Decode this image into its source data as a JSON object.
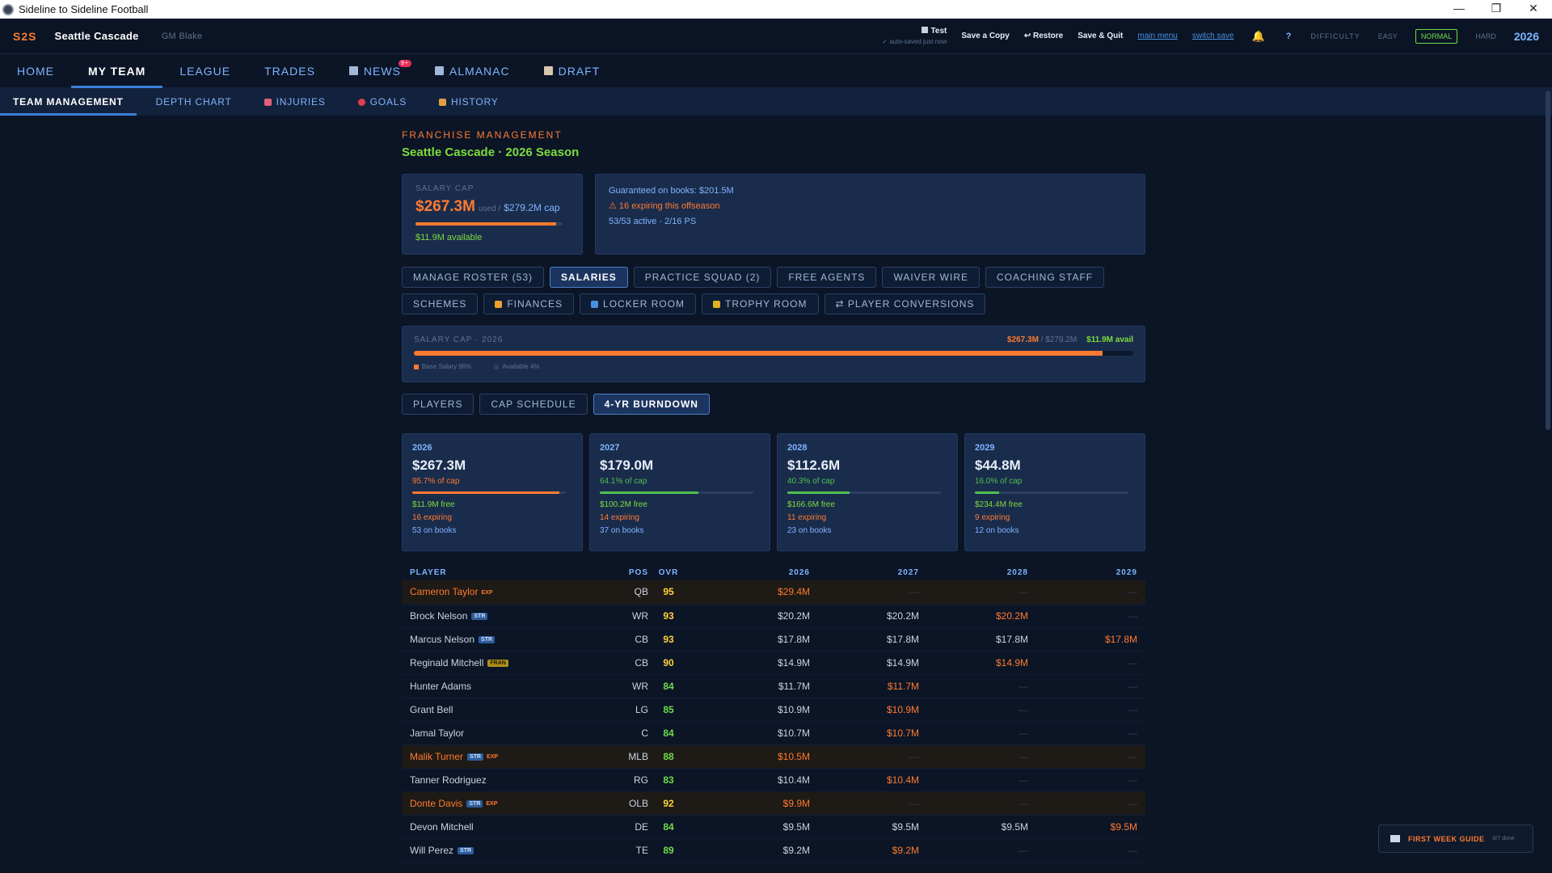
{
  "window": {
    "title": "Sideline to Sideline Football",
    "controls": [
      "—",
      "❐",
      "✕"
    ]
  },
  "topbar": {
    "logo": "S2S",
    "team": "Seattle Cascade",
    "gm": "GM Blake",
    "save_name": "Test",
    "save_status": "✓ auto-saved just now",
    "save_copy": "Save a Copy",
    "restore": "↩ Restore",
    "save_quit": "Save & Quit",
    "main_menu": "main menu",
    "switch_save": "switch save",
    "help": "?",
    "difficulty_label": "DIFFICULTY",
    "difficulty_options": [
      "EASY",
      "NORMAL",
      "HARD"
    ],
    "year": "2026"
  },
  "nav": {
    "items": [
      {
        "label": "HOME"
      },
      {
        "label": "MY TEAM",
        "active": true
      },
      {
        "label": "LEAGUE"
      },
      {
        "label": "TRADES"
      },
      {
        "label": "NEWS",
        "badge": "9+"
      },
      {
        "label": "ALMANAC"
      },
      {
        "label": "DRAFT"
      }
    ]
  },
  "subnav": {
    "items": [
      {
        "label": "TEAM MANAGEMENT",
        "active": true
      },
      {
        "label": "DEPTH CHART"
      },
      {
        "label": "INJURIES"
      },
      {
        "label": "GOALS"
      },
      {
        "label": "HISTORY"
      }
    ]
  },
  "header": {
    "eyebrow": "FRANCHISE MANAGEMENT",
    "season": "Seattle Cascade · 2026 Season"
  },
  "cap_card": {
    "label": "SALARY CAP",
    "used": "$267.3M",
    "used_label": "used /",
    "cap": "$279.2M cap",
    "used_fraction": 0.957,
    "available": "$11.9M available"
  },
  "info_card": {
    "guaranteed": "Guaranteed on books: $201.5M",
    "expiring": "⚠ 16 expiring this offseason",
    "active": "53/53 active · 2/16 PS"
  },
  "mgmt_buttons": [
    {
      "label": "MANAGE ROSTER (53)"
    },
    {
      "label": "SALARIES",
      "active": true
    },
    {
      "label": "PRACTICE SQUAD (2)"
    },
    {
      "label": "FREE AGENTS"
    },
    {
      "label": "WAIVER WIRE"
    },
    {
      "label": "COACHING STAFF"
    },
    {
      "label": "SCHEMES"
    },
    {
      "label": "FINANCES",
      "icon": "money-bag-icon",
      "color": "#f0a030"
    },
    {
      "label": "LOCKER ROOM",
      "icon": "helmet-icon",
      "color": "#4a8fe0"
    },
    {
      "label": "TROPHY ROOM",
      "icon": "trophy-icon",
      "color": "#e0b020"
    },
    {
      "label": "⇄ PLAYER CONVERSIONS"
    }
  ],
  "cap_summary": {
    "label": "SALARY CAP · 2026",
    "used": "$267.3M",
    "sep": "/",
    "cap": "$279.2M",
    "avail": "$11.9M avail",
    "used_fraction": 0.957,
    "legend": [
      "Base Salary 96%",
      "Available 4%"
    ]
  },
  "view_tabs": [
    {
      "label": "PLAYERS"
    },
    {
      "label": "CAP SCHEDULE"
    },
    {
      "label": "4-YR BURNDOWN",
      "active": true
    }
  ],
  "burndown": [
    {
      "year": "2026",
      "amount": "$267.3M",
      "pct": "95.7% of cap",
      "fraction": 0.957,
      "color": "#ff7a30",
      "free": "$11.9M free",
      "expiring": "16 expiring",
      "books": "53 on books"
    },
    {
      "year": "2027",
      "amount": "$179.0M",
      "pct": "64.1% of cap",
      "fraction": 0.641,
      "color": "#4ec050",
      "free": "$100.2M free",
      "expiring": "14 expiring",
      "books": "37 on books"
    },
    {
      "year": "2028",
      "amount": "$112.6M",
      "pct": "40.3% of cap",
      "fraction": 0.403,
      "color": "#4ec050",
      "free": "$166.6M free",
      "expiring": "11 expiring",
      "books": "23 on books"
    },
    {
      "year": "2029",
      "amount": "$44.8M",
      "pct": "16.0% of cap",
      "fraction": 0.16,
      "color": "#4ec050",
      "free": "$234.4M free",
      "expiring": "9 expiring",
      "books": "12 on books"
    }
  ],
  "table": {
    "headers": [
      "PLAYER",
      "POS",
      "OVR",
      "2026",
      "2027",
      "2028",
      "2029"
    ],
    "rows": [
      {
        "name": "Cameron Taylor",
        "tags": [
          "EXP"
        ],
        "pos": "QB",
        "ovr": "95",
        "ovr_color": "#ffd23c",
        "expiring": true,
        "y": [
          [
            "$29.4M",
            "hl"
          ],
          [
            "—",
            "dash"
          ],
          [
            "—",
            "dash"
          ],
          [
            "—",
            "dash"
          ]
        ]
      },
      {
        "name": "Brock Nelson",
        "tags": [
          "STR"
        ],
        "pos": "WR",
        "ovr": "93",
        "ovr_color": "#ffd23c",
        "y": [
          [
            "$20.2M",
            ""
          ],
          [
            "$20.2M",
            ""
          ],
          [
            "$20.2M",
            "hl"
          ],
          [
            "—",
            "dash"
          ]
        ]
      },
      {
        "name": "Marcus Nelson",
        "tags": [
          "STR"
        ],
        "pos": "CB",
        "ovr": "93",
        "ovr_color": "#ffd23c",
        "y": [
          [
            "$17.8M",
            ""
          ],
          [
            "$17.8M",
            ""
          ],
          [
            "$17.8M",
            ""
          ],
          [
            "$17.8M",
            "hl"
          ]
        ]
      },
      {
        "name": "Reginald Mitchell",
        "tags": [
          "FRAN"
        ],
        "pos": "CB",
        "ovr": "90",
        "ovr_color": "#ffd23c",
        "y": [
          [
            "$14.9M",
            ""
          ],
          [
            "$14.9M",
            ""
          ],
          [
            "$14.9M",
            "hl"
          ],
          [
            "—",
            "dash"
          ]
        ]
      },
      {
        "name": "Hunter Adams",
        "tags": [],
        "pos": "WR",
        "ovr": "84",
        "ovr_color": "#6fdc4a",
        "y": [
          [
            "$11.7M",
            ""
          ],
          [
            "$11.7M",
            "hl"
          ],
          [
            "—",
            "dash"
          ],
          [
            "—",
            "dash"
          ]
        ]
      },
      {
        "name": "Grant Bell",
        "tags": [],
        "pos": "LG",
        "ovr": "85",
        "ovr_color": "#6fdc4a",
        "y": [
          [
            "$10.9M",
            ""
          ],
          [
            "$10.9M",
            "hl"
          ],
          [
            "—",
            "dash"
          ],
          [
            "—",
            "dash"
          ]
        ]
      },
      {
        "name": "Jamal Taylor",
        "tags": [],
        "pos": "C",
        "ovr": "84",
        "ovr_color": "#6fdc4a",
        "y": [
          [
            "$10.7M",
            ""
          ],
          [
            "$10.7M",
            "hl"
          ],
          [
            "—",
            "dash"
          ],
          [
            "—",
            "dash"
          ]
        ]
      },
      {
        "name": "Malik Turner",
        "tags": [
          "STR",
          "EXP"
        ],
        "pos": "MLB",
        "ovr": "88",
        "ovr_color": "#6fdc4a",
        "expiring": true,
        "y": [
          [
            "$10.5M",
            "hl"
          ],
          [
            "—",
            "dash"
          ],
          [
            "—",
            "dash"
          ],
          [
            "—",
            "dash"
          ]
        ]
      },
      {
        "name": "Tanner Rodriguez",
        "tags": [],
        "pos": "RG",
        "ovr": "83",
        "ovr_color": "#6fdc4a",
        "y": [
          [
            "$10.4M",
            ""
          ],
          [
            "$10.4M",
            "hl"
          ],
          [
            "—",
            "dash"
          ],
          [
            "—",
            "dash"
          ]
        ]
      },
      {
        "name": "Donte Davis",
        "tags": [
          "STR",
          "EXP"
        ],
        "pos": "OLB",
        "ovr": "92",
        "ovr_color": "#ffd23c",
        "expiring": true,
        "y": [
          [
            "$9.9M",
            "hl"
          ],
          [
            "—",
            "dash"
          ],
          [
            "—",
            "dash"
          ],
          [
            "—",
            "dash"
          ]
        ]
      },
      {
        "name": "Devon Mitchell",
        "tags": [],
        "pos": "DE",
        "ovr": "84",
        "ovr_color": "#6fdc4a",
        "y": [
          [
            "$9.5M",
            ""
          ],
          [
            "$9.5M",
            ""
          ],
          [
            "$9.5M",
            ""
          ],
          [
            "$9.5M",
            "hl"
          ]
        ]
      },
      {
        "name": "Will Perez",
        "tags": [
          "STR"
        ],
        "pos": "TE",
        "ovr": "89",
        "ovr_color": "#6fdc4a",
        "y": [
          [
            "$9.2M",
            ""
          ],
          [
            "$9.2M",
            "hl"
          ],
          [
            "—",
            "dash"
          ],
          [
            "—",
            "dash"
          ]
        ]
      }
    ]
  },
  "guide": {
    "label": "FIRST WEEK GUIDE",
    "progress": "0/7 done"
  }
}
